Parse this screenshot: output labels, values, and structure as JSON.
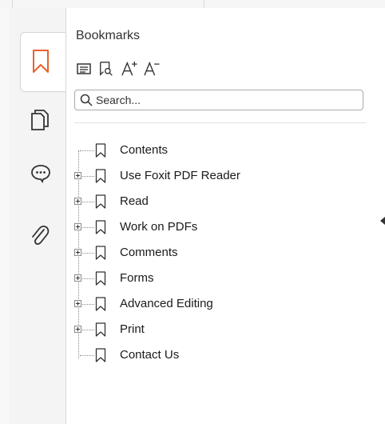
{
  "panel": {
    "title": "Bookmarks",
    "search_placeholder": "Search..."
  },
  "rail": {
    "tabs": [
      {
        "name": "bookmarks",
        "icon": "bookmark-icon",
        "active": true
      },
      {
        "name": "pages",
        "icon": "pages-icon",
        "active": false
      },
      {
        "name": "comments",
        "icon": "comment-icon",
        "active": false
      },
      {
        "name": "attachments",
        "icon": "paperclip-icon",
        "active": false
      }
    ]
  },
  "toolbar": [
    "expand-current-icon",
    "find-bookmark-icon",
    "increase-font-icon",
    "decrease-font-icon"
  ],
  "bookmarks": [
    {
      "label": "Contents",
      "expandable": false
    },
    {
      "label": "Use Foxit PDF Reader",
      "expandable": true
    },
    {
      "label": "Read",
      "expandable": true
    },
    {
      "label": "Work on PDFs",
      "expandable": true
    },
    {
      "label": "Comments",
      "expandable": true
    },
    {
      "label": "Forms",
      "expandable": true
    },
    {
      "label": "Advanced Editing",
      "expandable": true
    },
    {
      "label": "Print",
      "expandable": true
    },
    {
      "label": "Contact Us",
      "expandable": false
    }
  ],
  "colors": {
    "accent": "#e8632b",
    "icon": "#333333",
    "border": "#d6d6d6"
  }
}
